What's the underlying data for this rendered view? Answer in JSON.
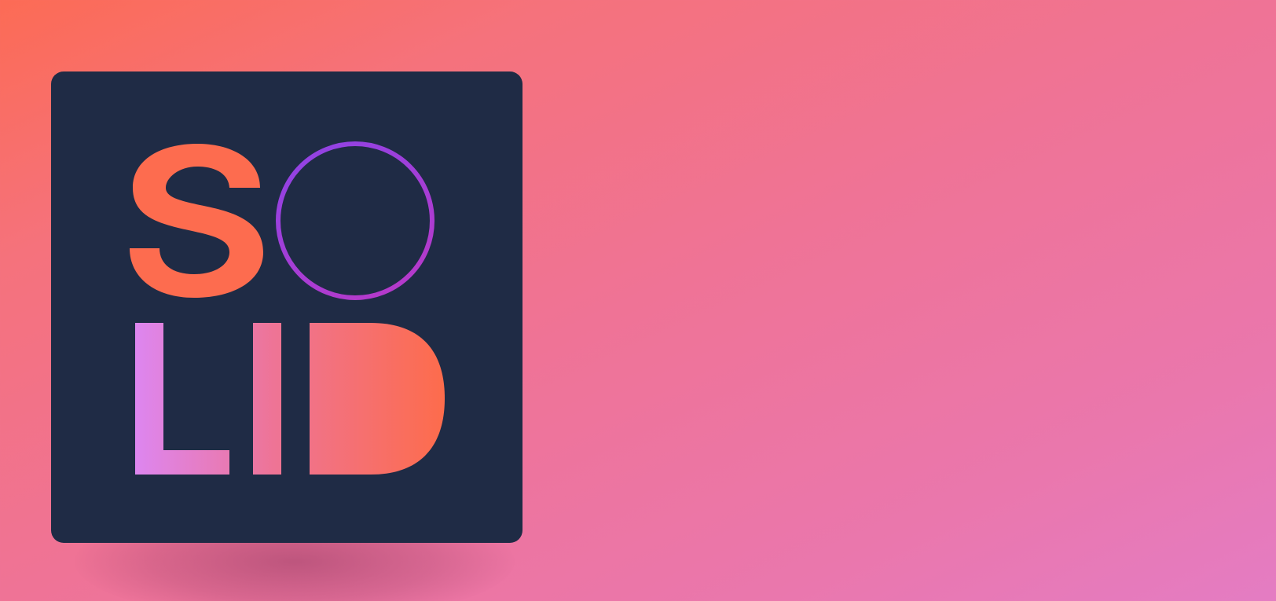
{
  "logo": {
    "text": "SOLID",
    "colors": {
      "background": "#1f2b45",
      "s_fill": "#fd6c4f",
      "o_ring_start": "#8e43e6",
      "o_ring_end": "#b53acb",
      "lid_gradient_start": "#dd86f1",
      "lid_gradient_mid": "#ee7496",
      "lid_gradient_end": "#fd6c4c"
    }
  },
  "page": {
    "background_start": "#fc6b55",
    "background_end": "#e47cc3"
  }
}
